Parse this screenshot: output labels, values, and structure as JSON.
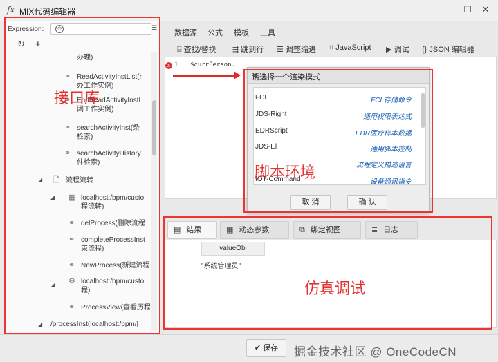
{
  "window": {
    "icon": "fx",
    "title": "MIX代码编辑器",
    "min": "—",
    "max": "☐",
    "close": "✕"
  },
  "left_panel": {
    "expression_label": "Expression:",
    "refresh_icon": "refresh-icon",
    "add_icon": "plus-icon",
    "tree": [
      {
        "label": "办理)"
      },
      {
        "label": "ReadActivityInstList(r"
      },
      {
        "label": "办工作实例)"
      },
      {
        "label": "EndReadActivityInstL"
      },
      {
        "label": "闭工作实例)"
      },
      {
        "label": "searchActivityInst(条"
      },
      {
        "label": "检索)"
      },
      {
        "label": "searchActivityHistory"
      },
      {
        "label": "件检索)"
      },
      {
        "label": "流程流转"
      },
      {
        "label": "localhost:/bpm/custo"
      },
      {
        "label": "程流转)"
      },
      {
        "label": "delProcess(删除流程"
      },
      {
        "label": "completeProcessInst"
      },
      {
        "label": "束流程)"
      },
      {
        "label": "NewProcess(新建流程"
      },
      {
        "label": "localhost:/bpm/custo"
      },
      {
        "label": "程)"
      },
      {
        "label": "ProcessView(查看历程"
      },
      {
        "label": "/processInst(localhost:/bpm/|"
      }
    ]
  },
  "menubar": [
    "数据源",
    "公式",
    "模板",
    "工具"
  ],
  "toolbar": [
    {
      "icon": "format-icon",
      "label": "查找/替换"
    },
    {
      "icon": "goto-icon",
      "label": "跳到行"
    },
    {
      "icon": "indent-icon",
      "label": "调整缩进"
    },
    {
      "icon": "js-icon",
      "label": "JavaScript"
    },
    {
      "icon": "play-icon",
      "label": "调试"
    },
    {
      "icon": "braces-icon",
      "label": "JSON 编辑器"
    }
  ],
  "editor": {
    "line_number": "1",
    "code": "$currPerson.",
    "error_marker": "x"
  },
  "dialog": {
    "title": "请选择一个渲染模式",
    "close": "✕",
    "options": [
      {
        "name": "FCL",
        "desc": "FCL存储命令"
      },
      {
        "name": "JDS-Right",
        "desc": "通用权限表达式"
      },
      {
        "name": "EDRScript",
        "desc": "EDR医疗样本数据"
      },
      {
        "name": "JDS-El",
        "desc": "通用脚本控制"
      },
      {
        "name": "",
        "desc": "流程定义描述语言"
      },
      {
        "name": "IOT-Command",
        "desc": "设备通讯指令"
      }
    ],
    "cancel": "取 消",
    "confirm": "确 认"
  },
  "bottom_tabs": [
    {
      "icon": "result-icon",
      "label": "结果"
    },
    {
      "icon": "calendar-icon",
      "label": "动态参数"
    },
    {
      "icon": "bind-icon",
      "label": "绑定视图"
    },
    {
      "icon": "database-icon",
      "label": "日志"
    }
  ],
  "result": {
    "column": "valueObj",
    "value": "\"系统管理员\""
  },
  "footer": {
    "save": "保存",
    "watermark": "掘金技术社区 @ OneCodeCN"
  },
  "annotations": {
    "api_lib": "接口库",
    "script_env": "脚本环境",
    "simulation": "仿真调试"
  },
  "colors": {
    "annotation_red": "#e33333",
    "link_blue": "#1a5fb4"
  }
}
